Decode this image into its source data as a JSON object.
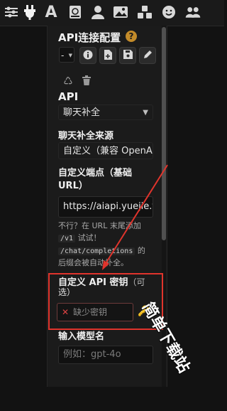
{
  "colors": {
    "background": "#121212",
    "panel": "#1b1b1b",
    "accent_help": "#c38b2a",
    "annotation_red": "#e0342c"
  },
  "toolbar": {
    "icons": [
      "sliders-icon",
      "plug-icon",
      "font-icon",
      "book-atlas-icon",
      "user-icon",
      "image-icon",
      "cubes-icon",
      "face-smile-icon",
      "users-icon"
    ]
  },
  "api_connection": {
    "title": "API连接配置",
    "help_glyph": "?",
    "profile_select": "-",
    "buttons": [
      "info-icon",
      "file-add-icon",
      "save-icon",
      "pencil-icon",
      "recycle-icon",
      "trash-icon"
    ]
  },
  "api": {
    "label": "API",
    "value": "聊天补全"
  },
  "source": {
    "label": "聊天补全来源",
    "value": "自定义（兼容 OpenAI）"
  },
  "endpoint": {
    "label_line1": "自定义端点（基础",
    "label_line2": "URL）",
    "value": "https://aiapi.yuejie.top",
    "hint_line1": "不行？在 URL 末尾添加",
    "hint_code1": "/v1",
    "hint_line2_suffix": "试试！",
    "hint_code2": "/chat/completions",
    "hint_line3_suffix": "的",
    "hint_line4": "后缀会被自动补全。"
  },
  "api_key": {
    "label": "自定义 API 密钥",
    "optional": "（可",
    "optional_line2": "选）",
    "placeholder": "缺少密钥",
    "x_glyph": "✕",
    "key_glyph": "🔑"
  },
  "model": {
    "label": "输入模型名",
    "placeholder": "例如：gpt-4o"
  },
  "watermark": {
    "text": "简单下载站"
  }
}
